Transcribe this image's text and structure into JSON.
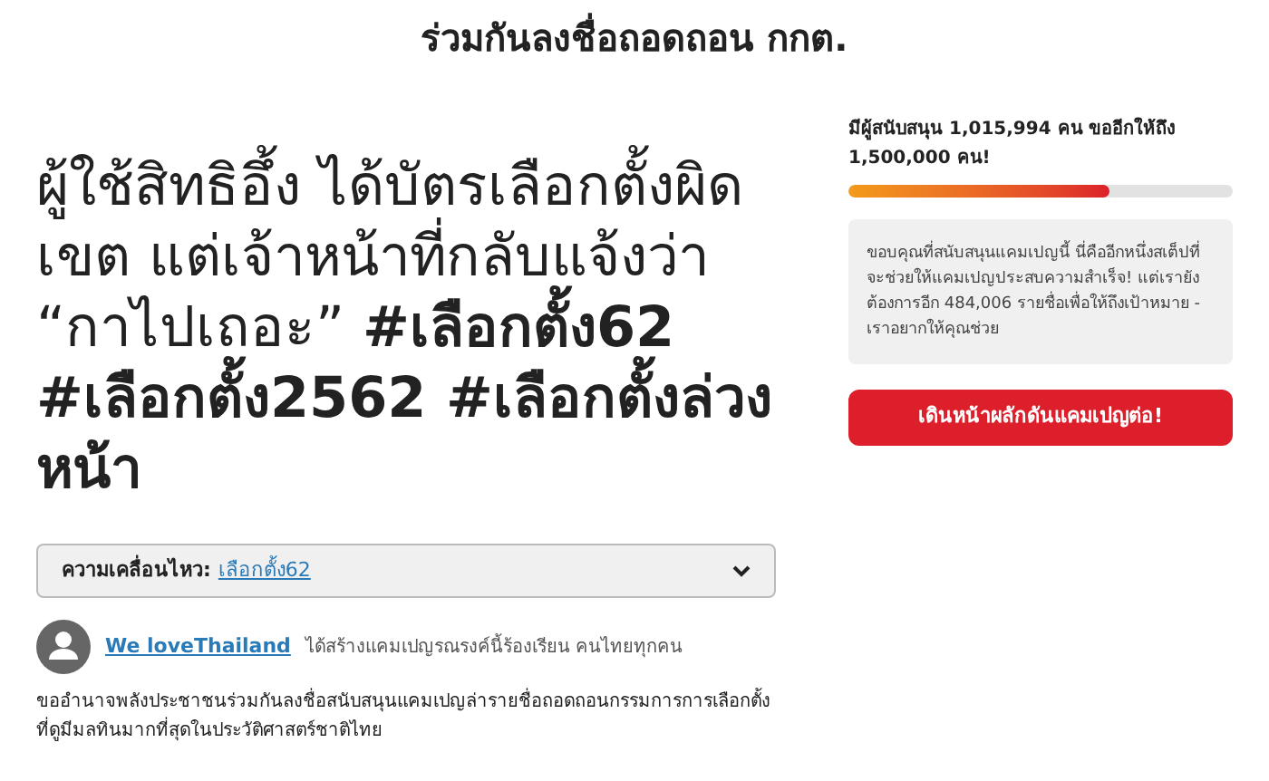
{
  "page_title": "ร่วมกันลงชื่อถอดถอน กกต.",
  "headline": {
    "plain": "ผู้ใช้สิทธิอึ้ง ได้บัตรเลือกตั้งผิดเขต แต่เจ้าหน้าที่กลับแจ้งว่า “กาไปเถอะ” ",
    "tags": "#เลือกตั้ง62 #เลือกตั้ง2562 #เลือกตั้งล่วงหน้า"
  },
  "movement": {
    "label": "ความเคลื่อนไหว:",
    "link": "เลือกตั้ง62",
    "expanded": false
  },
  "creator": {
    "name": "We loveThailand",
    "text": "ได้สร้างแคมเปญรณรงค์นี้ร้องเรียน คนไทยทุกคน"
  },
  "description": "ขออำนาจพลังประชาชนร่วมกันลงชื่อสนับสนุนแคมเปญล่ารายชื่อถอดถอนกรรมการการเลือกตั้งที่ดูมีมลทินมากที่สุดในประวัติศาสตร์ชาติไทย",
  "supporters": {
    "text": "มีผู้สนับสนุน 1,015,994 คน ขออีกให้ถึง 1,500,000 คน!",
    "level": 0.68
  },
  "thanks": "ขอบคุณที่สนับสนุนแคมเปญนี้ นี่คืออีกหนึ่งสเต็ปที่จะช่วยให้แคมเปญประสบความสำเร็จ! แต่เรายังต้องการอีก 484,006 รายชื่อเพื่อให้ถึงเป้าหมาย - เราอยากให้คุณช่วย",
  "cta_button": "เดินหน้าผลักดันแคมเปญต่อ!"
}
